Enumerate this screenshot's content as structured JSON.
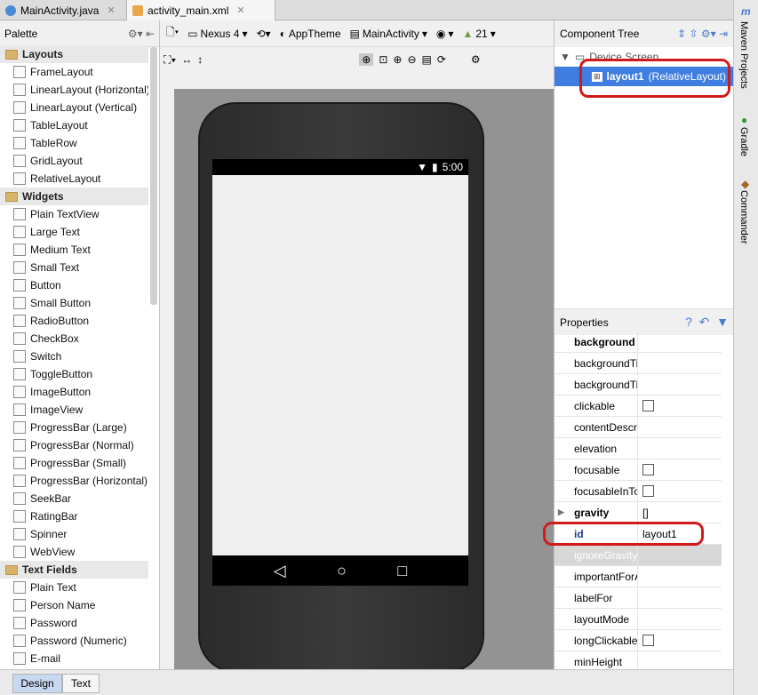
{
  "tabs": [
    {
      "label": "MainActivity.java",
      "active": false
    },
    {
      "label": "activity_main.xml",
      "active": true
    }
  ],
  "palette": {
    "title": "Palette",
    "categories": [
      {
        "name": "Layouts",
        "items": [
          "FrameLayout",
          "LinearLayout (Horizontal)",
          "LinearLayout (Vertical)",
          "TableLayout",
          "TableRow",
          "GridLayout",
          "RelativeLayout"
        ]
      },
      {
        "name": "Widgets",
        "items": [
          "Plain TextView",
          "Large Text",
          "Medium Text",
          "Small Text",
          "Button",
          "Small Button",
          "RadioButton",
          "CheckBox",
          "Switch",
          "ToggleButton",
          "ImageButton",
          "ImageView",
          "ProgressBar (Large)",
          "ProgressBar (Normal)",
          "ProgressBar (Small)",
          "ProgressBar (Horizontal)",
          "SeekBar",
          "RatingBar",
          "Spinner",
          "WebView"
        ]
      },
      {
        "name": "Text Fields",
        "items": [
          "Plain Text",
          "Person Name",
          "Password",
          "Password (Numeric)",
          "E-mail"
        ]
      }
    ]
  },
  "toolbar": {
    "device": "Nexus 4",
    "theme": "AppTheme",
    "activity": "MainActivity",
    "api": "21"
  },
  "device": {
    "time": "5:00"
  },
  "component_tree": {
    "title": "Component Tree",
    "root": "Device Screen",
    "child_id": "layout1",
    "child_type": "(RelativeLayout)"
  },
  "properties": {
    "title": "Properties",
    "rows": [
      {
        "name": "background",
        "value": "",
        "bold": true
      },
      {
        "name": "backgroundTint",
        "value": ""
      },
      {
        "name": "backgroundTintMode",
        "value": ""
      },
      {
        "name": "clickable",
        "value": "",
        "checkbox": true
      },
      {
        "name": "contentDescription",
        "value": ""
      },
      {
        "name": "elevation",
        "value": ""
      },
      {
        "name": "focusable",
        "value": "",
        "checkbox": true
      },
      {
        "name": "focusableInTouchMode",
        "value": "",
        "checkbox": true
      },
      {
        "name": "gravity",
        "value": "[]",
        "bold": true,
        "expandable": true
      },
      {
        "name": "id",
        "value": "layout1",
        "bold": true,
        "highlight": true
      },
      {
        "name": "ignoreGravity",
        "value": "",
        "disabled": true
      },
      {
        "name": "importantForAccessibility",
        "value": ""
      },
      {
        "name": "labelFor",
        "value": ""
      },
      {
        "name": "layoutMode",
        "value": ""
      },
      {
        "name": "longClickable",
        "value": "",
        "checkbox": true
      },
      {
        "name": "minHeight",
        "value": ""
      }
    ]
  },
  "side_tools": [
    "Maven Projects",
    "Gradle",
    "Commander"
  ],
  "bottom_tabs": [
    {
      "label": "Design",
      "active": true
    },
    {
      "label": "Text",
      "active": false
    }
  ],
  "colors": {
    "accent": "#3f7de0",
    "annotation": "#d21a1a"
  }
}
